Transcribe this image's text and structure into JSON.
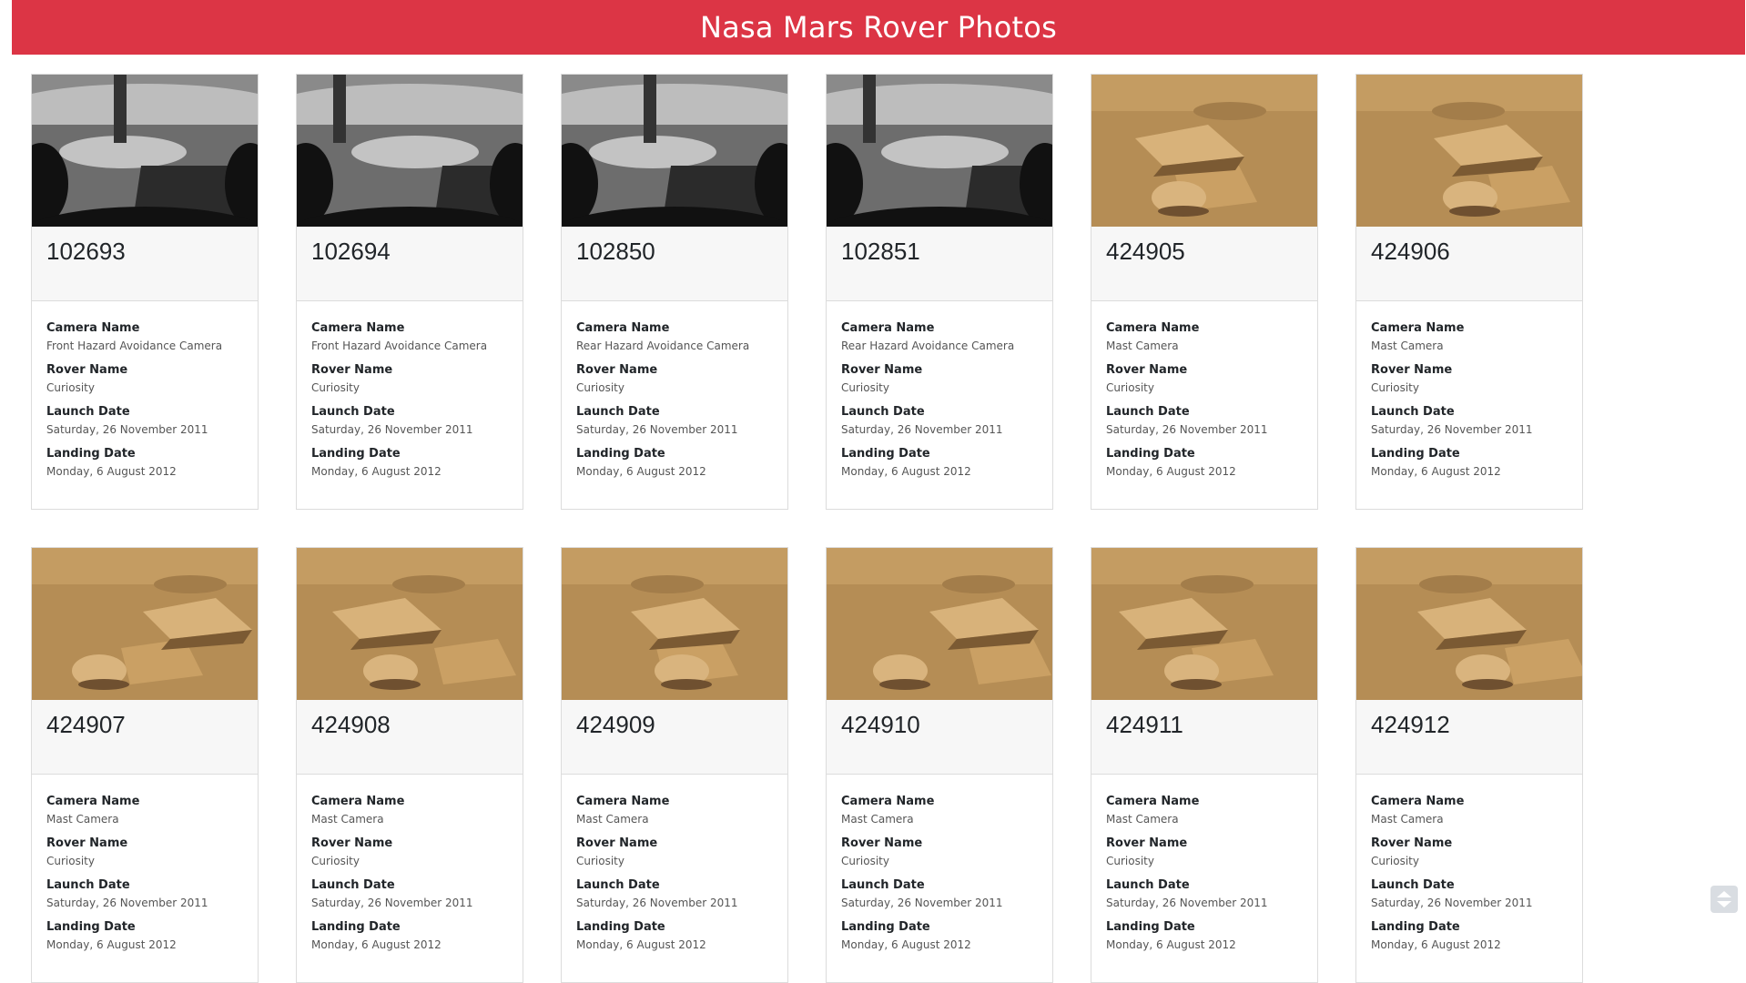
{
  "header": {
    "title": "Nasa Mars Rover Photos"
  },
  "labels": {
    "camera": "Camera Name",
    "rover": "Rover Name",
    "launch": "Launch Date",
    "landing": "Landing Date"
  },
  "photos": [
    {
      "id": "102693",
      "camera": "Front Hazard Avoidance Camera",
      "rover": "Curiosity",
      "launch": "Saturday, 26 November 2011",
      "landing": "Monday, 6 August 2012"
    },
    {
      "id": "102694",
      "camera": "Front Hazard Avoidance Camera",
      "rover": "Curiosity",
      "launch": "Saturday, 26 November 2011",
      "landing": "Monday, 6 August 2012"
    },
    {
      "id": "102850",
      "camera": "Rear Hazard Avoidance Camera",
      "rover": "Curiosity",
      "launch": "Saturday, 26 November 2011",
      "landing": "Monday, 6 August 2012"
    },
    {
      "id": "102851",
      "camera": "Rear Hazard Avoidance Camera",
      "rover": "Curiosity",
      "launch": "Saturday, 26 November 2011",
      "landing": "Monday, 6 August 2012"
    },
    {
      "id": "424905",
      "camera": "Mast Camera",
      "rover": "Curiosity",
      "launch": "Saturday, 26 November 2011",
      "landing": "Monday, 6 August 2012"
    },
    {
      "id": "424906",
      "camera": "Mast Camera",
      "rover": "Curiosity",
      "launch": "Saturday, 26 November 2011",
      "landing": "Monday, 6 August 2012"
    },
    {
      "id": "424907",
      "camera": "Mast Camera",
      "rover": "Curiosity",
      "launch": "Saturday, 26 November 2011",
      "landing": "Monday, 6 August 2012"
    },
    {
      "id": "424908",
      "camera": "Mast Camera",
      "rover": "Curiosity",
      "launch": "Saturday, 26 November 2011",
      "landing": "Monday, 6 August 2012"
    },
    {
      "id": "424909",
      "camera": "Mast Camera",
      "rover": "Curiosity",
      "launch": "Saturday, 26 November 2011",
      "landing": "Monday, 6 August 2012"
    },
    {
      "id": "424910",
      "camera": "Mast Camera",
      "rover": "Curiosity",
      "launch": "Saturday, 26 November 2011",
      "landing": "Monday, 6 August 2012"
    },
    {
      "id": "424911",
      "camera": "Mast Camera",
      "rover": "Curiosity",
      "launch": "Saturday, 26 November 2011",
      "landing": "Monday, 6 August 2012"
    },
    {
      "id": "424912",
      "camera": "Mast Camera",
      "rover": "Curiosity",
      "launch": "Saturday, 26 November 2011",
      "landing": "Monday, 6 August 2012"
    }
  ],
  "colors": {
    "header_bg": "#dc3545",
    "card_head_bg": "#f7f7f7",
    "scroll_button": "#d9dde2"
  },
  "icons": {
    "scroll": "scroll-up-down-icon"
  }
}
